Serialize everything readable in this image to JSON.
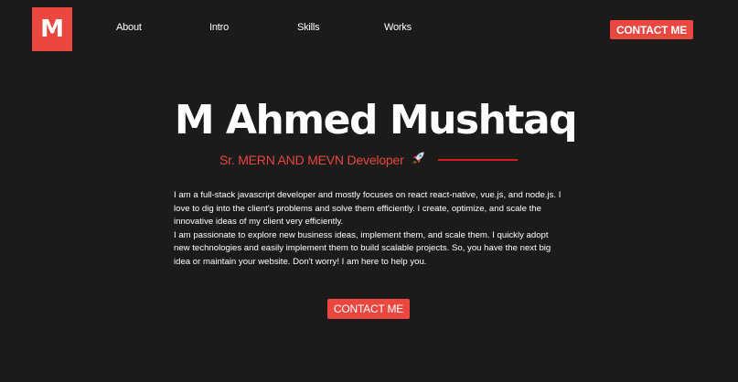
{
  "logo": {
    "letter": "M"
  },
  "nav": {
    "items": [
      {
        "label": "About"
      },
      {
        "label": "Intro"
      },
      {
        "label": "Skills"
      },
      {
        "label": "Works"
      }
    ],
    "contact_label": "CONTACT ME"
  },
  "hero": {
    "name": "M Ahmed Mushtaq",
    "subtitle": "Sr. MERN AND MEVN Developer",
    "subtitle_icon": "rocket-icon",
    "bio_paragraphs": [
      "I am a full-stack javascript developer and mostly focuses on react react-native, vue.js, and node.js. I love to dig into the client's problems and solve them efficiently. I create, optimize, and scale the innovative ideas of my client very efficiently.",
      "I am passionate to explore new business ideas, implement them, and scale them. I quickly adopt new technologies and easily implement them to build scalable projects. So, you have the next big idea or maintain your website. Don't worry! I am here to help you."
    ],
    "cta_label": "CONTACT ME"
  },
  "colors": {
    "background": "#1c1b1b",
    "accent": "#e9473f",
    "line": "#d41e1e",
    "text": "#ffffff"
  }
}
